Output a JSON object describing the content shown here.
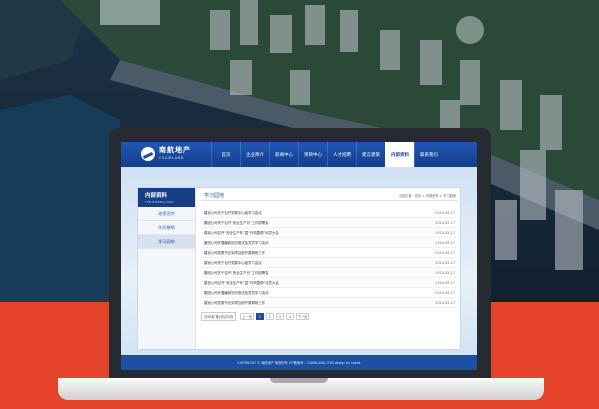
{
  "colors": {
    "accent": "#1d4fa5",
    "sidebar_head": "#163f86",
    "background_band": "#e5442b",
    "laptop_bezel": "#262a31"
  },
  "logo": {
    "name_cn": "南航地产",
    "name_en": "CSAIRLAND"
  },
  "nav": {
    "items": [
      "首页",
      "企业简介",
      "新闻中心",
      "项目中心",
      "人才招聘",
      "建言建策",
      "内部资料",
      "联系我们"
    ],
    "active_index": 6
  },
  "sidebar": {
    "title": "内部资料",
    "subtitle": "THE INTERNAL DATA",
    "items": [
      "政策宣传",
      "作风整顿",
      "学习园地"
    ],
    "active_index": 2
  },
  "content": {
    "title": "学习园地",
    "breadcrumb": "当前位置：首页 > 内部资料 > 学习园地"
  },
  "list": [
    {
      "title": "建设公司关于召开党委中心组学习会议",
      "date": "2014-05-17"
    },
    {
      "title": "集团公司关于召开“安全生产月”工作部署会",
      "date": "2014-05-17"
    },
    {
      "title": "建设公司召开“安全生产年”暨“作风整顿”动员大会",
      "date": "2014-05-17"
    },
    {
      "title": "集团公司开展廉政知识测试及党员学习活动",
      "date": "2014-05-17"
    },
    {
      "title": "建设公司党委书记到项目部开展调研工作",
      "date": "2014-05-17"
    },
    {
      "title": "建设公司关于召开党委中心组学习会议",
      "date": "2014-05-17"
    },
    {
      "title": "集团公司关于召开“安全生产月”工作部署会",
      "date": "2014-05-17"
    },
    {
      "title": "建设公司召开“安全生产年”暨“作风整顿”动员大会",
      "date": "2014-05-17"
    },
    {
      "title": "集团公司开展廉政知识测试及党员学习活动",
      "date": "2014-05-17"
    },
    {
      "title": "建设公司党委书记到项目部开展调研工作",
      "date": "2014-05-17"
    }
  ],
  "pager": {
    "info": "共40条 第1页/共4页",
    "prev": "上一页",
    "pages": [
      "1",
      "2",
      "3",
      "4"
    ],
    "current_index": 0,
    "next": "下一页"
  },
  "footer": {
    "text": "COPYRIGHT © 南航地产 版权所有 ICP备案号：CSAIRLAND.COM   design by seeds"
  }
}
